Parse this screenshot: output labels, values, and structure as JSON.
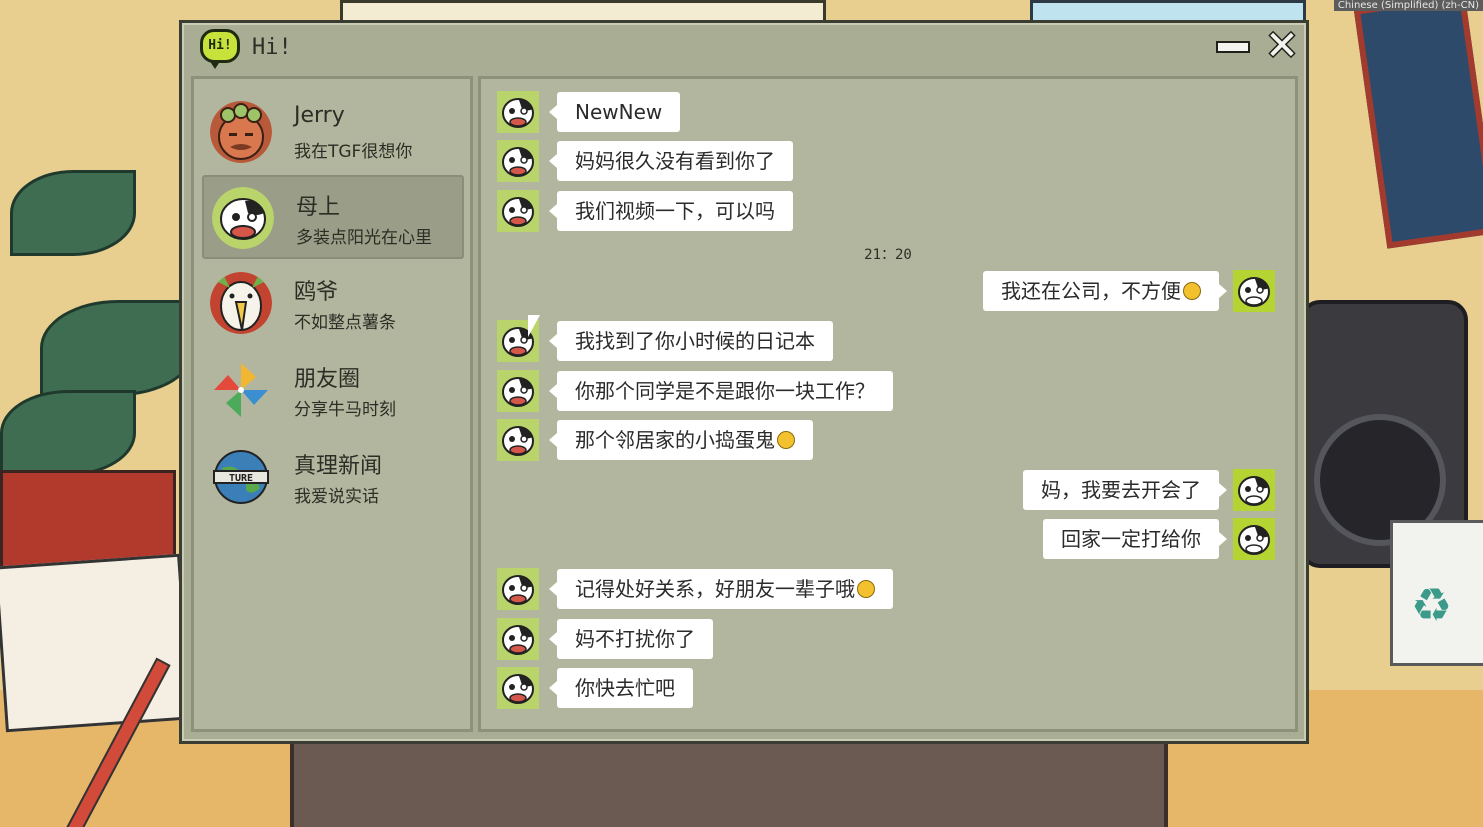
{
  "system": {
    "language_badge": "Chinese (Simplified) (zh-CN)"
  },
  "window": {
    "logo_text": "Hi!",
    "title": "Hi!",
    "minimize_icon": "minimize-icon",
    "close_icon": "close-icon"
  },
  "contacts": [
    {
      "name": "Jerry",
      "preview": "我在TGF很想你",
      "avatar": "jerry-avatar-icon",
      "active": false
    },
    {
      "name": "母上",
      "preview": "多装点阳光在心里",
      "avatar": "cow-mother-avatar-icon",
      "active": true
    },
    {
      "name": "鸥爷",
      "preview": "不如整点薯条",
      "avatar": "seagull-avatar-icon",
      "active": false
    },
    {
      "name": "朋友圈",
      "preview": "分享牛马时刻",
      "avatar": "pinwheel-icon",
      "active": false
    },
    {
      "name": "真理新闻",
      "preview": "我爱说实话",
      "avatar": "globe-news-icon",
      "active": false
    }
  ],
  "chat": {
    "timestamp": "21：20",
    "messages": [
      {
        "side": "left",
        "text": "NewNew"
      },
      {
        "side": "left",
        "text": "妈妈很久没有看到你了"
      },
      {
        "side": "left",
        "text": "我们视频一下，可以吗"
      },
      {
        "side": "right",
        "text": "我还在公司，不方便",
        "emoji": true
      },
      {
        "side": "left",
        "text": "我找到了你小时候的日记本"
      },
      {
        "side": "left",
        "text": "你那个同学是不是跟你一块工作？"
      },
      {
        "side": "left",
        "text": "那个邻居家的小捣蛋鬼",
        "emoji": true
      },
      {
        "side": "right",
        "text": "妈，我要去开会了"
      },
      {
        "side": "right",
        "text": "回家一定打给你"
      },
      {
        "side": "left",
        "text": "记得处好关系，好朋友一辈子哦",
        "emoji": true
      },
      {
        "side": "left",
        "text": "妈不打扰你了"
      },
      {
        "side": "left",
        "text": "你快去忙吧"
      }
    ]
  },
  "colors": {
    "window_bg": "#a9ad93",
    "panel_bg": "#b3b69f",
    "active_contact": "#9a9d87",
    "bubble": "#ffffff",
    "logo_green": "#c7e23a"
  }
}
